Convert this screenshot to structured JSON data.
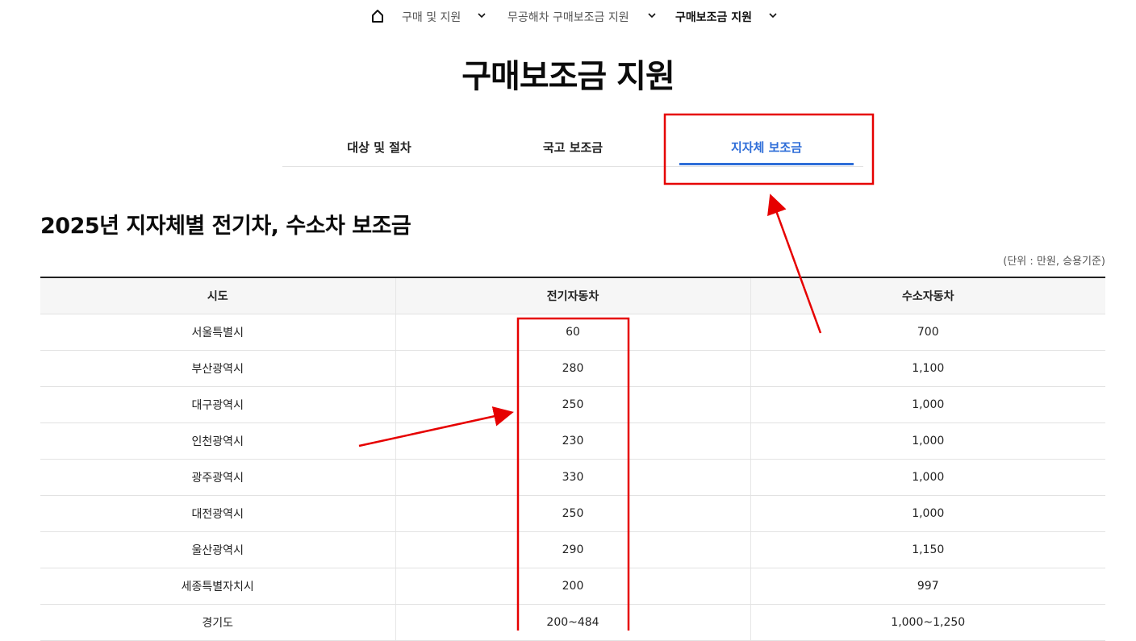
{
  "breadcrumb": {
    "home_icon": "home-icon",
    "items": [
      {
        "label": "구매 및 지원"
      },
      {
        "label": "무공해차 구매보조금 지원"
      },
      {
        "label": "구매보조금 지원"
      }
    ]
  },
  "page_title": "구매보조금 지원",
  "tabs": [
    {
      "label": "대상 및 절차",
      "active": false
    },
    {
      "label": "국고 보조금",
      "active": false
    },
    {
      "label": "지자체 보조금",
      "active": true
    }
  ],
  "section_title": "2025년 지자체별 전기차, 수소차 보조금",
  "unit_note": "(단위 : 만원, 승용기준)",
  "table": {
    "headers": [
      "시도",
      "전기자동차",
      "수소자동차"
    ],
    "rows": [
      [
        "서울특별시",
        "60",
        "700"
      ],
      [
        "부산광역시",
        "280",
        "1,100"
      ],
      [
        "대구광역시",
        "250",
        "1,000"
      ],
      [
        "인천광역시",
        "230",
        "1,000"
      ],
      [
        "광주광역시",
        "330",
        "1,000"
      ],
      [
        "대전광역시",
        "250",
        "1,000"
      ],
      [
        "울산광역시",
        "290",
        "1,150"
      ],
      [
        "세종특별자치시",
        "200",
        "997"
      ],
      [
        "경기도",
        "200~484",
        "1,000~1,250"
      ]
    ]
  },
  "colors": {
    "accent": "#2f6ed8",
    "annotation": "#e60000",
    "header_bg": "#f6f6f6"
  }
}
